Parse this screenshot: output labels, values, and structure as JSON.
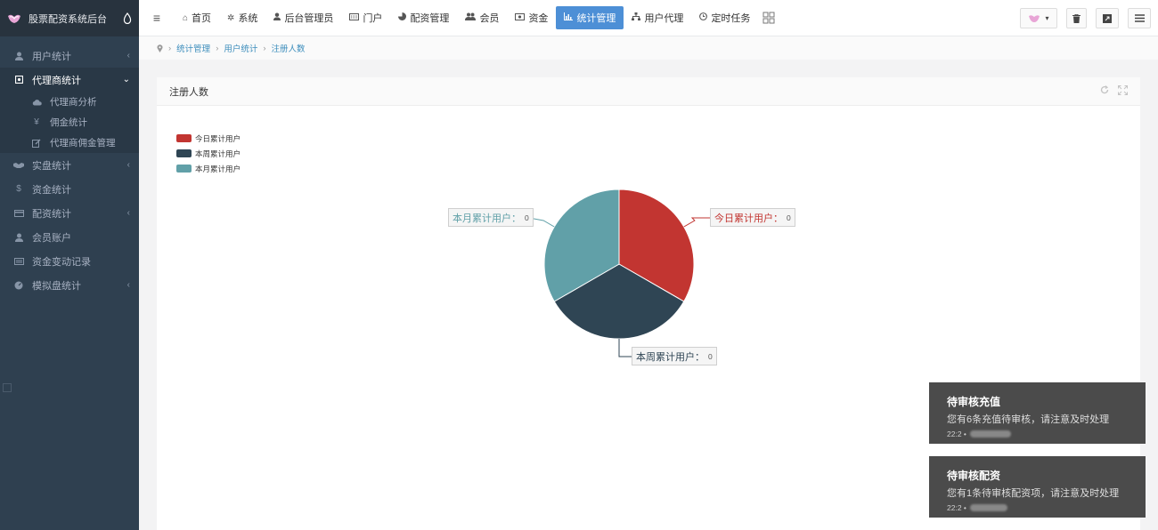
{
  "sidebar": {
    "brand_title": "股票配资系统后台",
    "items": [
      {
        "label": "用户统计",
        "icon": "user-icon",
        "has_arrow": true
      },
      {
        "label": "代理商统计",
        "icon": "square-icon",
        "active": true,
        "has_arrow": true,
        "children": [
          {
            "label": "代理商分析",
            "icon": "cloud-icon"
          },
          {
            "label": "佣金统计",
            "icon": "yen-icon"
          },
          {
            "label": "代理商佣金管理",
            "icon": "edit-icon"
          }
        ]
      },
      {
        "label": "实盘统计",
        "icon": "handshake-icon",
        "has_arrow": true
      },
      {
        "label": "资金统计",
        "icon": "dollar-icon"
      },
      {
        "label": "配资统计",
        "icon": "credit-card-icon",
        "has_arrow": true
      },
      {
        "label": "会员账户",
        "icon": "user-icon"
      },
      {
        "label": "资金变动记录",
        "icon": "list-icon"
      },
      {
        "label": "模拟盘统计",
        "icon": "gauge-icon",
        "has_arrow": true
      }
    ]
  },
  "topbar": {
    "tabs": [
      {
        "label": "首页",
        "icon": "home-icon"
      },
      {
        "label": "系统",
        "icon": "gear-icon"
      },
      {
        "label": "后台管理员",
        "icon": "user-icon"
      },
      {
        "label": "门户",
        "icon": "keyboard-icon"
      },
      {
        "label": "配资管理",
        "icon": "pie-icon"
      },
      {
        "label": "会员",
        "icon": "users-icon"
      },
      {
        "label": "资金",
        "icon": "money-icon"
      },
      {
        "label": "统计管理",
        "icon": "bar-chart-icon",
        "active": true
      },
      {
        "label": "用户代理",
        "icon": "sitemap-icon"
      },
      {
        "label": "定时任务",
        "icon": "clock-icon"
      }
    ]
  },
  "breadcrumb": [
    "统计管理",
    "用户统计",
    "注册人数"
  ],
  "panel": {
    "title": "注册人数"
  },
  "chart_data": {
    "type": "pie",
    "series": [
      {
        "name": "今日累计用户",
        "value": 0,
        "color": "#c23531"
      },
      {
        "name": "本周累计用户",
        "value": 0,
        "color": "#2f4554"
      },
      {
        "name": "本月累计用户",
        "value": 0,
        "color": "#61a0a8"
      }
    ],
    "label_separator": "："
  },
  "toasts": [
    {
      "title": "待审核充值",
      "message": "您有6条充值待审核，请注意及时处理",
      "time": "22:2"
    },
    {
      "title": "待审核配资",
      "message": "您有1条待审核配资项，请注意及时处理",
      "time": "22:2"
    }
  ]
}
